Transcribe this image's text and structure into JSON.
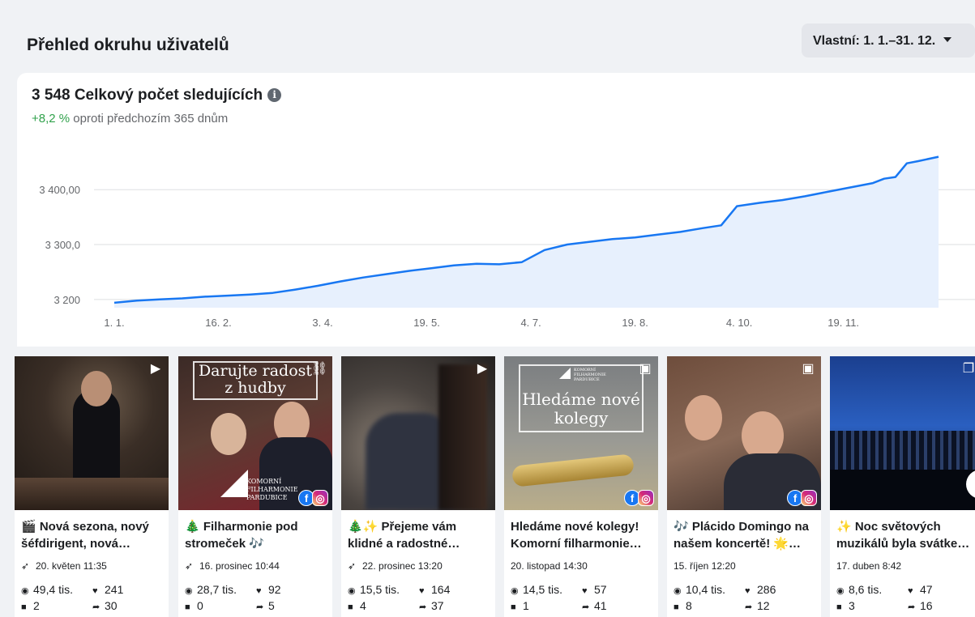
{
  "header": {
    "title": "Přehled okruhu uživatelů",
    "range_label": "Vlastní: 1. 1.–31. 12."
  },
  "kpi": {
    "value_label": "3 548 Celkový počet sledujících",
    "delta_pct": "+8,2 %",
    "delta_text": "oproti předchozím 365 dnům"
  },
  "chart_data": {
    "type": "area",
    "title": "",
    "xlabel": "",
    "ylabel": "",
    "ylim": [
      3185,
      3480
    ],
    "y_ticks": [
      3200,
      3300,
      3400
    ],
    "y_tick_labels": [
      "3 200",
      "3 300,0",
      "3 400,00"
    ],
    "x_tick_labels": [
      "1. 1.",
      "16. 2.",
      "3. 4.",
      "19. 5.",
      "4. 7.",
      "19. 8.",
      "4. 10.",
      "19. 11."
    ],
    "x_tick_days": [
      0,
      46,
      92,
      138,
      184,
      230,
      276,
      322
    ],
    "x_range": [
      0,
      364
    ],
    "grid": true,
    "color": "#1877f2",
    "series": [
      {
        "x": [
          0,
          10,
          20,
          30,
          40,
          50,
          60,
          70,
          80,
          90,
          100,
          110,
          120,
          130,
          140,
          150,
          160,
          170,
          180,
          190,
          200,
          210,
          220,
          230,
          240,
          250,
          260,
          268,
          275,
          285,
          295,
          305,
          315,
          325,
          335,
          340,
          345,
          350,
          355,
          364
        ],
        "y": [
          3194,
          3198,
          3200,
          3202,
          3205,
          3207,
          3209,
          3212,
          3218,
          3225,
          3233,
          3240,
          3246,
          3252,
          3257,
          3262,
          3265,
          3264,
          3268,
          3290,
          3300,
          3305,
          3310,
          3313,
          3318,
          3323,
          3330,
          3335,
          3370,
          3376,
          3381,
          3388,
          3396,
          3404,
          3412,
          3420,
          3423,
          3448,
          3452,
          3460
        ]
      }
    ]
  },
  "posts": [
    {
      "caption": "🎬 Nová sezona, nový šéfdirigent, nová…",
      "date": "20. květen 11:35",
      "boosted": true,
      "views": "49,4 tis.",
      "likes": "241",
      "comments": "2",
      "shares": "30",
      "type_icon": "reel-icon",
      "platforms": []
    },
    {
      "caption": "🎄 Filharmonie pod stromeček 🎶",
      "date": "16. prosinec 10:44",
      "boosted": true,
      "views": "28,7 tis.",
      "likes": "92",
      "comments": "0",
      "shares": "5",
      "type_icon": "link-icon",
      "platforms": [
        "facebook",
        "instagram"
      ],
      "overlay_title": "Darujte radost z hudby",
      "overlay_logo": "KOMORNÍ FILHARMONIE PARDUBICE"
    },
    {
      "caption": "🎄✨ Přejeme vám klidné a radostné…",
      "date": "22. prosinec 13:20",
      "boosted": true,
      "views": "15,5 tis.",
      "likes": "164",
      "comments": "4",
      "shares": "37",
      "type_icon": "reel-icon",
      "platforms": []
    },
    {
      "caption": "Hledáme nové kolegy! Komorní filharmonie…",
      "date": "20. listopad 14:30",
      "boosted": false,
      "views": "14,5 tis.",
      "likes": "57",
      "comments": "1",
      "shares": "41",
      "type_icon": "photo-icon",
      "platforms": [
        "facebook",
        "instagram"
      ],
      "overlay_title": "Hledáme nové kolegy",
      "overlay_logo": "KOMORNÍ FILHARMONIE PARDUBICE"
    },
    {
      "caption": "🎶 Plácido Domingo na našem koncertě! 🌟…",
      "date": "15. říjen 12:20",
      "boosted": false,
      "views": "10,4 tis.",
      "likes": "286",
      "comments": "8",
      "shares": "12",
      "type_icon": "photo-icon",
      "platforms": [
        "facebook",
        "instagram"
      ]
    },
    {
      "caption": "✨ Noc světových muzikálů byla svátke…",
      "date": "17. duben 8:42",
      "boosted": false,
      "views": "8,6 tis.",
      "likes": "47",
      "comments": "3",
      "shares": "16",
      "type_icon": "album-icon",
      "platforms": []
    }
  ]
}
